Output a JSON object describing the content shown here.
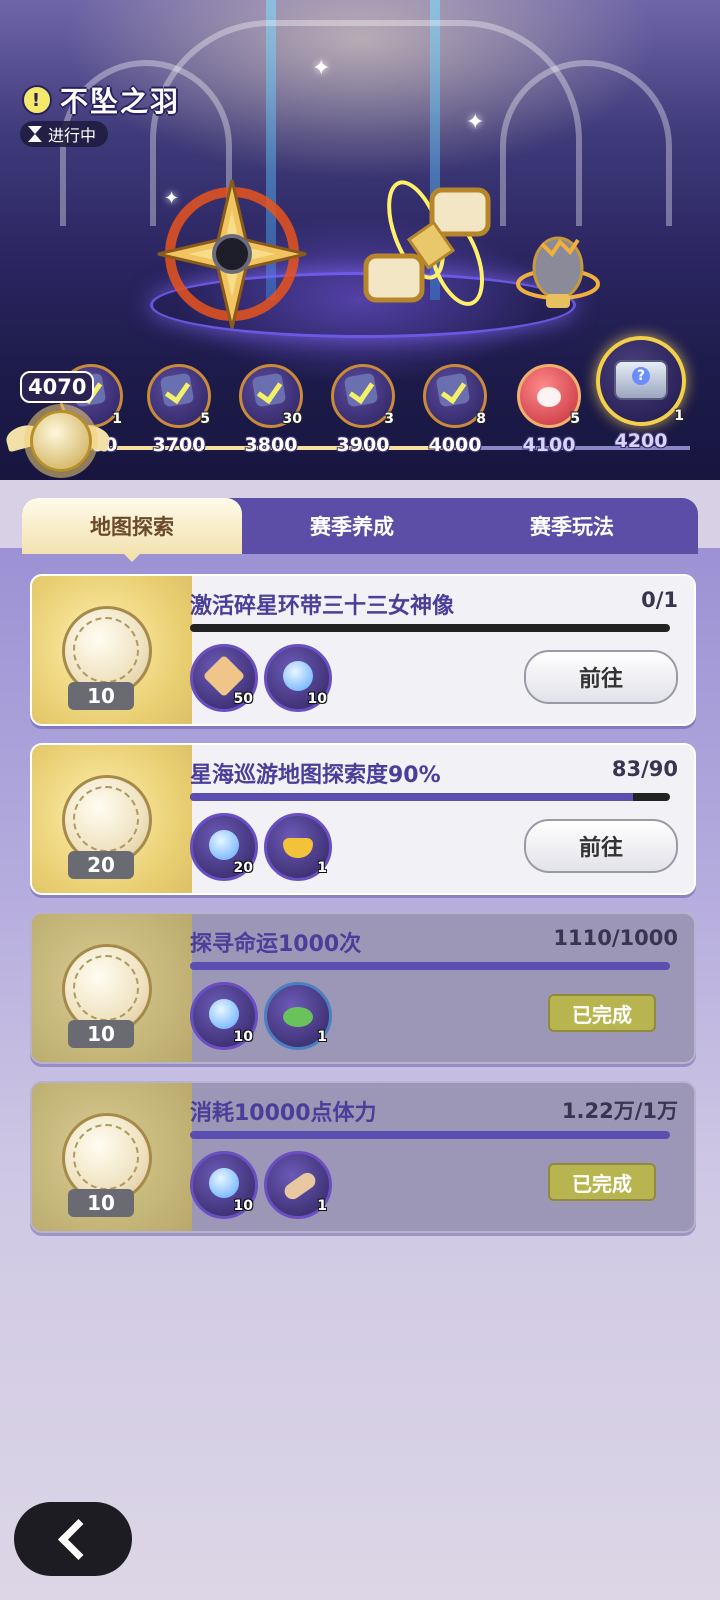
{
  "event": {
    "title": "不坠之羽",
    "status": "进行中"
  },
  "points": {
    "current": "4070"
  },
  "milestones": [
    {
      "value": "3600",
      "count": "1",
      "icon": "check-ticket-icon"
    },
    {
      "value": "3700",
      "count": "5",
      "icon": "check-ticket-icon"
    },
    {
      "value": "3800",
      "count": "30",
      "icon": "check-ticket-icon"
    },
    {
      "value": "3900",
      "count": "3",
      "icon": "check-ticket-icon"
    },
    {
      "value": "4000",
      "count": "8",
      "icon": "check-ticket-icon"
    },
    {
      "value": "4100",
      "count": "5",
      "icon": "paw-icon"
    },
    {
      "value": "4200",
      "count": "1",
      "icon": "chest-icon"
    }
  ],
  "tabs": [
    {
      "label": "地图探索",
      "active": true
    },
    {
      "label": "赛季养成",
      "active": false
    },
    {
      "label": "赛季玩法",
      "active": false
    }
  ],
  "tasks": [
    {
      "title": "激活碎星环带三十三女神像",
      "progress": "0/1",
      "progress_ratio": 0,
      "reward": "10",
      "items": [
        {
          "icon": "star-shard-icon",
          "qty": "50"
        },
        {
          "icon": "orb-icon",
          "qty": "10"
        }
      ],
      "action": "前往",
      "done": false
    },
    {
      "title": "星海巡游地图探索度90%",
      "progress": "83/90",
      "progress_ratio": 0.922,
      "reward": "20",
      "items": [
        {
          "icon": "orb-icon",
          "qty": "20"
        },
        {
          "icon": "gold-ingot-icon",
          "qty": "1"
        }
      ],
      "action": "前往",
      "done": false
    },
    {
      "title": "探寻命运1000次",
      "progress": "1110/1000",
      "progress_ratio": 1,
      "reward": "10",
      "items": [
        {
          "icon": "orb-icon",
          "qty": "10"
        },
        {
          "icon": "food-bowl-icon",
          "qty": "1"
        }
      ],
      "action": "已完成",
      "done": true
    },
    {
      "title": "消耗10000点体力",
      "progress": "1.22万/1万",
      "progress_ratio": 1,
      "reward": "10",
      "items": [
        {
          "icon": "orb-icon",
          "qty": "10"
        },
        {
          "icon": "scroll-icon",
          "qty": "1"
        }
      ],
      "action": "已完成",
      "done": true
    }
  ]
}
